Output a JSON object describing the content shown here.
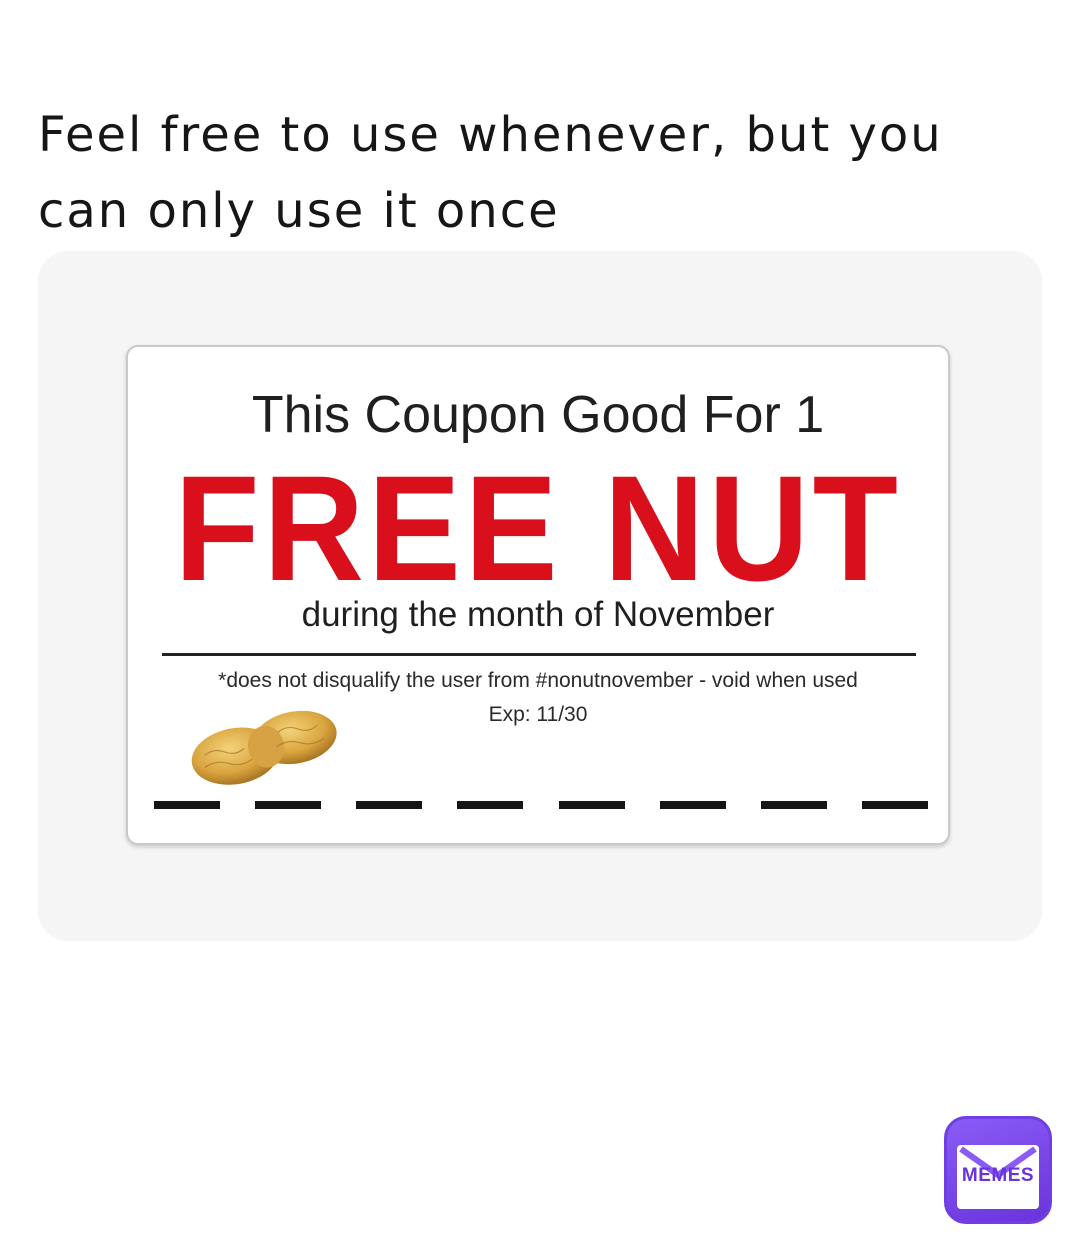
{
  "post": {
    "caption": "Feel free to use whenever, but you can only use it once"
  },
  "coupon": {
    "headline": "This Coupon Good For 1",
    "offer": "FREE NUT",
    "subline": "during the month of November",
    "fine_print": "*does not disqualify the user from #nonutnovember - void when used",
    "expiry": "Exp: 11/30",
    "offer_color": "#d9101c",
    "illustration": "peanut"
  },
  "watermark": {
    "label": "MEMES",
    "icon": "envelope-icon",
    "color": "#6a33db"
  }
}
